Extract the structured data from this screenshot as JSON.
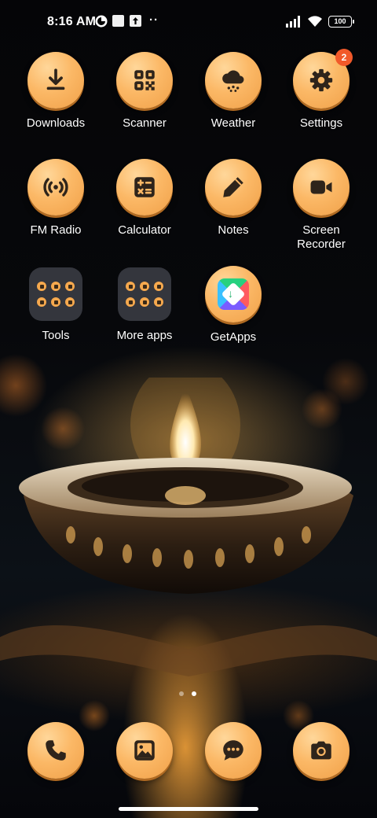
{
  "status_bar": {
    "time": "8:16 AM",
    "battery": "100",
    "overflow": "··"
  },
  "apps": [
    {
      "label": "Downloads",
      "icon": "download-icon"
    },
    {
      "label": "Scanner",
      "icon": "qr-scanner-icon"
    },
    {
      "label": "Weather",
      "icon": "rain-cloud-icon"
    },
    {
      "label": "Settings",
      "icon": "gear-icon",
      "badge": "2"
    },
    {
      "label": "FM Radio",
      "icon": "radio-broadcast-icon"
    },
    {
      "label": "Calculator",
      "icon": "calculator-icon"
    },
    {
      "label": "Notes",
      "icon": "pencil-icon"
    },
    {
      "label": "Screen Recorder",
      "icon": "video-camera-icon"
    },
    {
      "label": "Tools",
      "icon": "folder-icon"
    },
    {
      "label": "More apps",
      "icon": "folder-icon"
    },
    {
      "label": "GetApps",
      "icon": "getapps-store-icon"
    }
  ],
  "dock": [
    {
      "name": "phone",
      "icon": "phone-icon"
    },
    {
      "name": "gallery",
      "icon": "gallery-icon"
    },
    {
      "name": "messages",
      "icon": "chat-bubble-icon"
    },
    {
      "name": "camera",
      "icon": "camera-icon"
    }
  ],
  "colors": {
    "icon_fill": "#fbb866",
    "glyph": "#2e241b",
    "badge": "#f1592a"
  },
  "pages": {
    "count": 2,
    "active": 2
  }
}
